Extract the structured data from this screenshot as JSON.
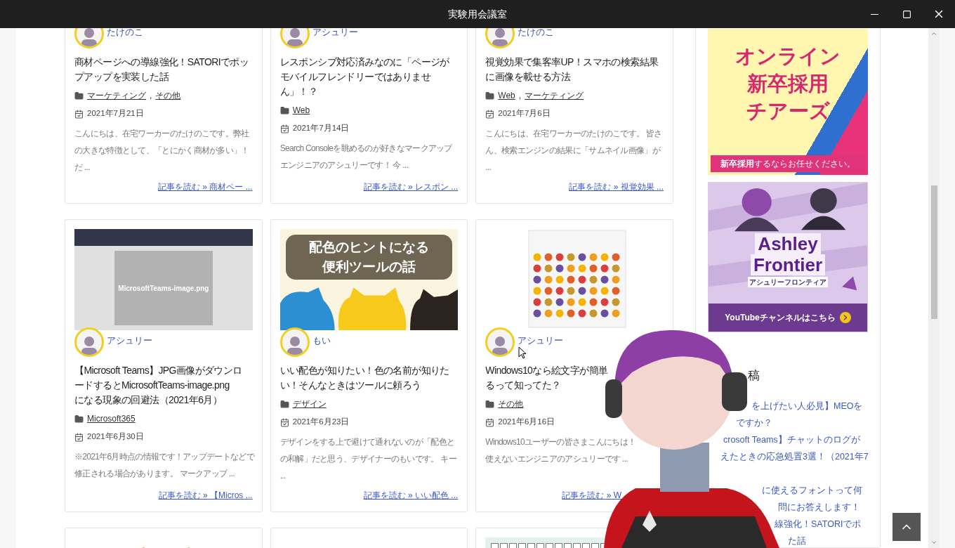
{
  "window": {
    "title": "実験用会議室"
  },
  "separator": ",",
  "cards": [
    {
      "author": "たけのこ",
      "title_lines": [
        "商材ページへの導線強化！SATORIでポッ",
        "プアップを実装した話"
      ],
      "categories": [
        "マーケティング",
        "その他"
      ],
      "date": "2021年7月21日",
      "excerpt_lines": [
        "こんにちは、在宅ワーカーのたけのこです。弊社",
        "の大きな特徴として、「とにかく商材が多い」！",
        "だ ..."
      ],
      "link": "記事を読む » 商材ペー ..."
    },
    {
      "author": "アシュリー",
      "title_lines": [
        "レスポンシブ対応済みなのに「ページが",
        "モバイルフレンドリーではありませ",
        "ん」！？"
      ],
      "categories": [
        "Web"
      ],
      "date": "2021年7月14日",
      "excerpt_lines": [
        "Search Consoleを眺めるのが好きなマークアップ",
        "エンジニアのアシュリーです！ 今 ..."
      ],
      "link": "記事を読む » レスポン ..."
    },
    {
      "author": "たけのこ",
      "title_lines": [
        "視覚効果で集客率UP！スマホの検索結果",
        "に画像を載せる方法"
      ],
      "categories": [
        "Web",
        "マーケティング"
      ],
      "date": "2021年7月6日",
      "excerpt_lines": [
        "こんにちは、在宅ワーカーのたけのこです。 皆さ",
        "ん、検索エンジンの結果に「サムネイル画像」が",
        "..."
      ],
      "link": "記事を読む » 視覚効果 ..."
    },
    {
      "image": {
        "kind": "screenshot",
        "caption": "MicrosoftTeams-image.png"
      },
      "author": "アシュリー",
      "title_lines": [
        "【Microsoft Teams】JPG画像がダウンロ",
        "ードするとMicrosoftTeams-image.png",
        "になる現象の回避法（2021年6月）"
      ],
      "categories": [
        "Microsoft365"
      ],
      "date": "2021年6月30日",
      "excerpt_lines": [
        "※2021年6月時点の情報です！アップデートなどで",
        "修正される場合があります。 マークアップ ..."
      ],
      "link": "記事を読む » 【Micros ..."
    },
    {
      "image": {
        "kind": "eyecatch",
        "lines": [
          "配色のヒントになる",
          "便利ツールの話"
        ]
      },
      "author": "もい",
      "title_lines": [
        "いい配色が知りたい！色の名前が知りた",
        "い！そんなときはツールに頼ろう"
      ],
      "categories": [
        "デザイン"
      ],
      "date": "2021年6月23日",
      "excerpt_lines": [
        "デザインをする上で避けて通れないのが「配色と",
        "の和解」だと思う、デザイナーのもいです。 キー",
        "..."
      ],
      "link": "記事を読む » いい配色 ..."
    },
    {
      "image": {
        "kind": "emoji-panel"
      },
      "author": "アシュリー",
      "title_lines": [
        "Windows10なら絵文字が簡単",
        "るって知ってた？"
      ],
      "categories": [
        "その他"
      ],
      "date": "2021年6月16日",
      "excerpt_lines": [
        "Windows10ユーザーの皆さまこんにちは！",
        "使えないエンジニアのアシュリーです ..."
      ],
      "link": "記事を読む » W"
    },
    {
      "kind": "stub",
      "image": {
        "kind": "leaves"
      }
    },
    {
      "kind": "stub"
    },
    {
      "kind": "stub",
      "image": {
        "kind": "keyboard"
      }
    }
  ],
  "sidebar": {
    "banners": [
      {
        "kind": "recruit",
        "lines": [
          "オンライン",
          "新卒採用",
          "チアーズ"
        ],
        "footer": "**新卒採用**するならお任せください。"
      },
      {
        "kind": "channel",
        "title_lines": [
          "Ashley",
          "Frontier"
        ],
        "subtitle": "アシュリーフロンティア",
        "footer": "YouTubeチャンネルはこちら"
      }
    ],
    "recent_heading": "稿",
    "recent_lines": [
      "を上げたい人必見】MEOを",
      "ですか？",
      "crosoft Teams】チャットのログが",
      "えたときの応急処置3選！（2021年7",
      "に使えるフォントって何",
      "問にお答えします！",
      "線強化！SATORIでポ",
      "た話"
    ]
  }
}
